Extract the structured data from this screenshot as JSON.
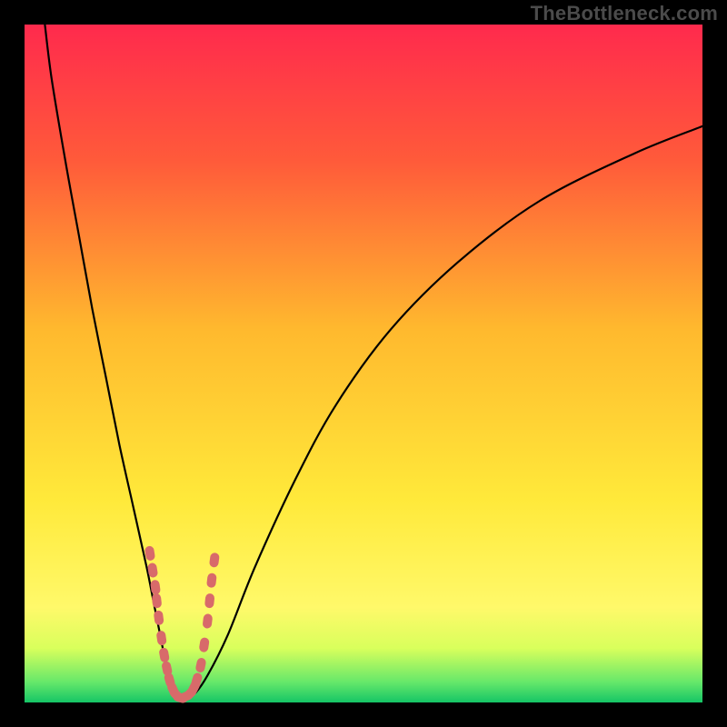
{
  "watermark": "TheBottleneck.com",
  "colors": {
    "gradient_stops": [
      {
        "pct": 0,
        "color": "#ff2a4d"
      },
      {
        "pct": 20,
        "color": "#ff5a3a"
      },
      {
        "pct": 45,
        "color": "#ffb92e"
      },
      {
        "pct": 70,
        "color": "#ffe93a"
      },
      {
        "pct": 86,
        "color": "#fff96a"
      },
      {
        "pct": 92,
        "color": "#d9ff5c"
      },
      {
        "pct": 97,
        "color": "#66e86a"
      },
      {
        "pct": 100,
        "color": "#15c566"
      }
    ],
    "curve": "#000000",
    "marker": "#d86a6a",
    "frame": "#000000"
  },
  "chart_data": {
    "type": "line",
    "title": "",
    "xlabel": "",
    "ylabel": "",
    "xlim": [
      0,
      100
    ],
    "ylim": [
      0,
      100
    ],
    "series": [
      {
        "name": "bottleneck-curve",
        "x": [
          3,
          4,
          6,
          8,
          10,
          12,
          14,
          16,
          18,
          19,
          20,
          20.8,
          21.6,
          22.4,
          23.3,
          25,
          27,
          30,
          34,
          40,
          46,
          54,
          64,
          76,
          90,
          100
        ],
        "y": [
          100,
          92,
          80,
          69,
          58,
          48,
          38,
          29,
          20,
          15,
          10,
          6,
          3,
          1.4,
          0.6,
          1.2,
          4,
          10,
          20,
          33,
          44,
          55,
          65,
          74,
          81,
          85
        ]
      }
    ],
    "markers": {
      "name": "highlight-points",
      "x_range": [
        18.5,
        27.5
      ],
      "points": [
        {
          "x": 18.5,
          "y": 22
        },
        {
          "x": 18.9,
          "y": 19.5
        },
        {
          "x": 19.3,
          "y": 17
        },
        {
          "x": 19.5,
          "y": 15
        },
        {
          "x": 19.8,
          "y": 12.5
        },
        {
          "x": 20.2,
          "y": 9.5
        },
        {
          "x": 20.6,
          "y": 7
        },
        {
          "x": 21.0,
          "y": 5
        },
        {
          "x": 21.4,
          "y": 3.3
        },
        {
          "x": 21.9,
          "y": 1.9
        },
        {
          "x": 22.4,
          "y": 1.1
        },
        {
          "x": 23.0,
          "y": 0.7
        },
        {
          "x": 23.6,
          "y": 0.8
        },
        {
          "x": 24.4,
          "y": 1.3
        },
        {
          "x": 25.0,
          "y": 2.2
        },
        {
          "x": 25.4,
          "y": 3.3
        },
        {
          "x": 26.0,
          "y": 5.5
        },
        {
          "x": 26.5,
          "y": 8.5
        },
        {
          "x": 27.0,
          "y": 12
        },
        {
          "x": 27.3,
          "y": 15
        },
        {
          "x": 27.6,
          "y": 18
        },
        {
          "x": 28.0,
          "y": 21
        }
      ]
    }
  }
}
